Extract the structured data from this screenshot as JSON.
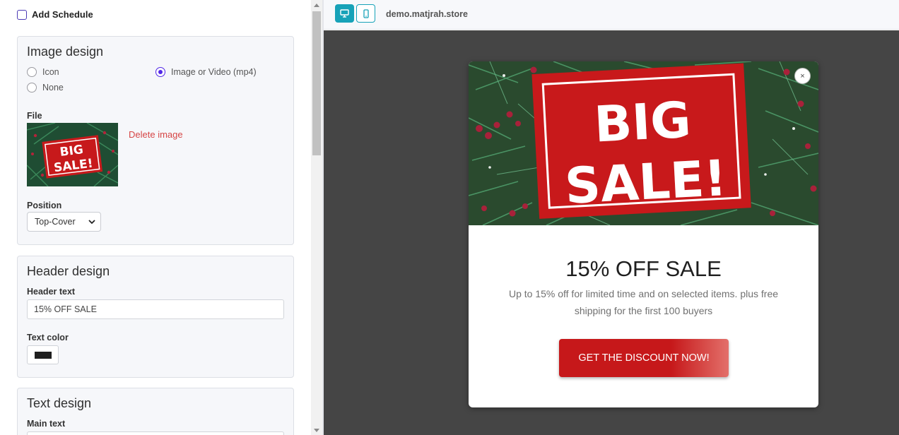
{
  "schedule": {
    "label": "Add Schedule",
    "checked": false
  },
  "image_design": {
    "title": "Image design",
    "options": [
      {
        "label": "Icon",
        "checked": false
      },
      {
        "label": "Image or Video (mp4)",
        "checked": true
      },
      {
        "label": "None",
        "checked": false
      }
    ],
    "file_label": "File",
    "delete_label": "Delete image",
    "thumbnail_text": [
      "BIG",
      "SALE!"
    ],
    "position_label": "Position",
    "position_value": "Top-Cover"
  },
  "header_design": {
    "title": "Header design",
    "header_text_label": "Header text",
    "header_text_value": "15% OFF SALE",
    "text_color_label": "Text color",
    "text_color": "#1f1f1f"
  },
  "text_design": {
    "title": "Text design",
    "main_text_label": "Main text"
  },
  "preview": {
    "domain": "demo.matjrah.store",
    "devices": [
      "desktop-icon",
      "mobile-icon"
    ],
    "popup": {
      "image_text": [
        "BIG",
        "SALE!"
      ],
      "close_symbol": "×",
      "header": "15% OFF SALE",
      "body": "Up to 15% off for limited time and on selected items. plus free shipping for the first 100 buyers",
      "cta": "GET THE DISCOUNT NOW!"
    }
  },
  "colors": {
    "accent": "#5127e6",
    "teal": "#17a2b8",
    "delete": "#d64545",
    "cta": "#c6181a",
    "preview_bg": "#454545"
  }
}
